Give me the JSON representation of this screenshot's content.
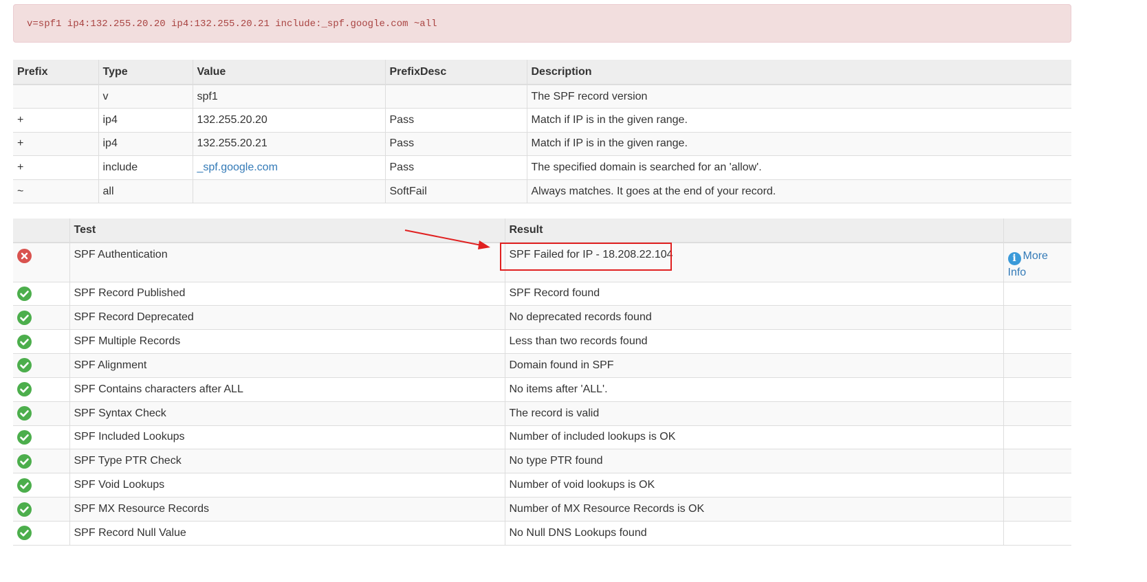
{
  "spf_record": "v=spf1 ip4:132.255.20.20 ip4:132.255.20.21 include:_spf.google.com ~all",
  "record_table": {
    "headers": [
      "Prefix",
      "Type",
      "Value",
      "PrefixDesc",
      "Description"
    ],
    "rows": [
      {
        "prefix": "",
        "type": "v",
        "value": "spf1",
        "prefix_desc": "",
        "description": "The SPF record version"
      },
      {
        "prefix": "+",
        "type": "ip4",
        "value": "132.255.20.20",
        "prefix_desc": "Pass",
        "description": "Match if IP is in the given range."
      },
      {
        "prefix": "+",
        "type": "ip4",
        "value": "132.255.20.21",
        "prefix_desc": "Pass",
        "description": "Match if IP is in the given range."
      },
      {
        "prefix": "+",
        "type": "include",
        "value": "_spf.google.com",
        "prefix_desc": "Pass",
        "description": "The specified domain is searched for an 'allow'."
      },
      {
        "prefix": "~",
        "type": "all",
        "value": "",
        "prefix_desc": "SoftFail",
        "description": "Always matches. It goes at the end of your record."
      }
    ]
  },
  "test_table": {
    "headers": [
      "",
      "Test",
      "Result",
      ""
    ],
    "more_info_label": "More Info",
    "rows": [
      {
        "status": "fail",
        "test": "SPF Authentication",
        "result": "SPF Failed for IP - 18.208.22.104"
      },
      {
        "status": "pass",
        "test": "SPF Record Published",
        "result": "SPF Record found"
      },
      {
        "status": "pass",
        "test": "SPF Record Deprecated",
        "result": "No deprecated records found"
      },
      {
        "status": "pass",
        "test": "SPF Multiple Records",
        "result": "Less than two records found"
      },
      {
        "status": "pass",
        "test": "SPF Alignment",
        "result": "Domain found in SPF"
      },
      {
        "status": "pass",
        "test": "SPF Contains characters after ALL",
        "result": "No items after 'ALL'."
      },
      {
        "status": "pass",
        "test": "SPF Syntax Check",
        "result": "The record is valid"
      },
      {
        "status": "pass",
        "test": "SPF Included Lookups",
        "result": "Number of included lookups is OK"
      },
      {
        "status": "pass",
        "test": "SPF Type PTR Check",
        "result": "No type PTR found"
      },
      {
        "status": "pass",
        "test": "SPF Void Lookups",
        "result": "Number of void lookups is OK"
      },
      {
        "status": "pass",
        "test": "SPF MX Resource Records",
        "result": "Number of MX Resource Records is OK"
      },
      {
        "status": "pass",
        "test": "SPF Record Null Value",
        "result": "No Null DNS Lookups found"
      }
    ]
  },
  "colors": {
    "pass": "#4cae4c",
    "fail": "#d9534f",
    "annotation": "#e02020",
    "link": "#337ab7",
    "alert_bg": "#f2dede",
    "alert_text": "#a94442"
  }
}
